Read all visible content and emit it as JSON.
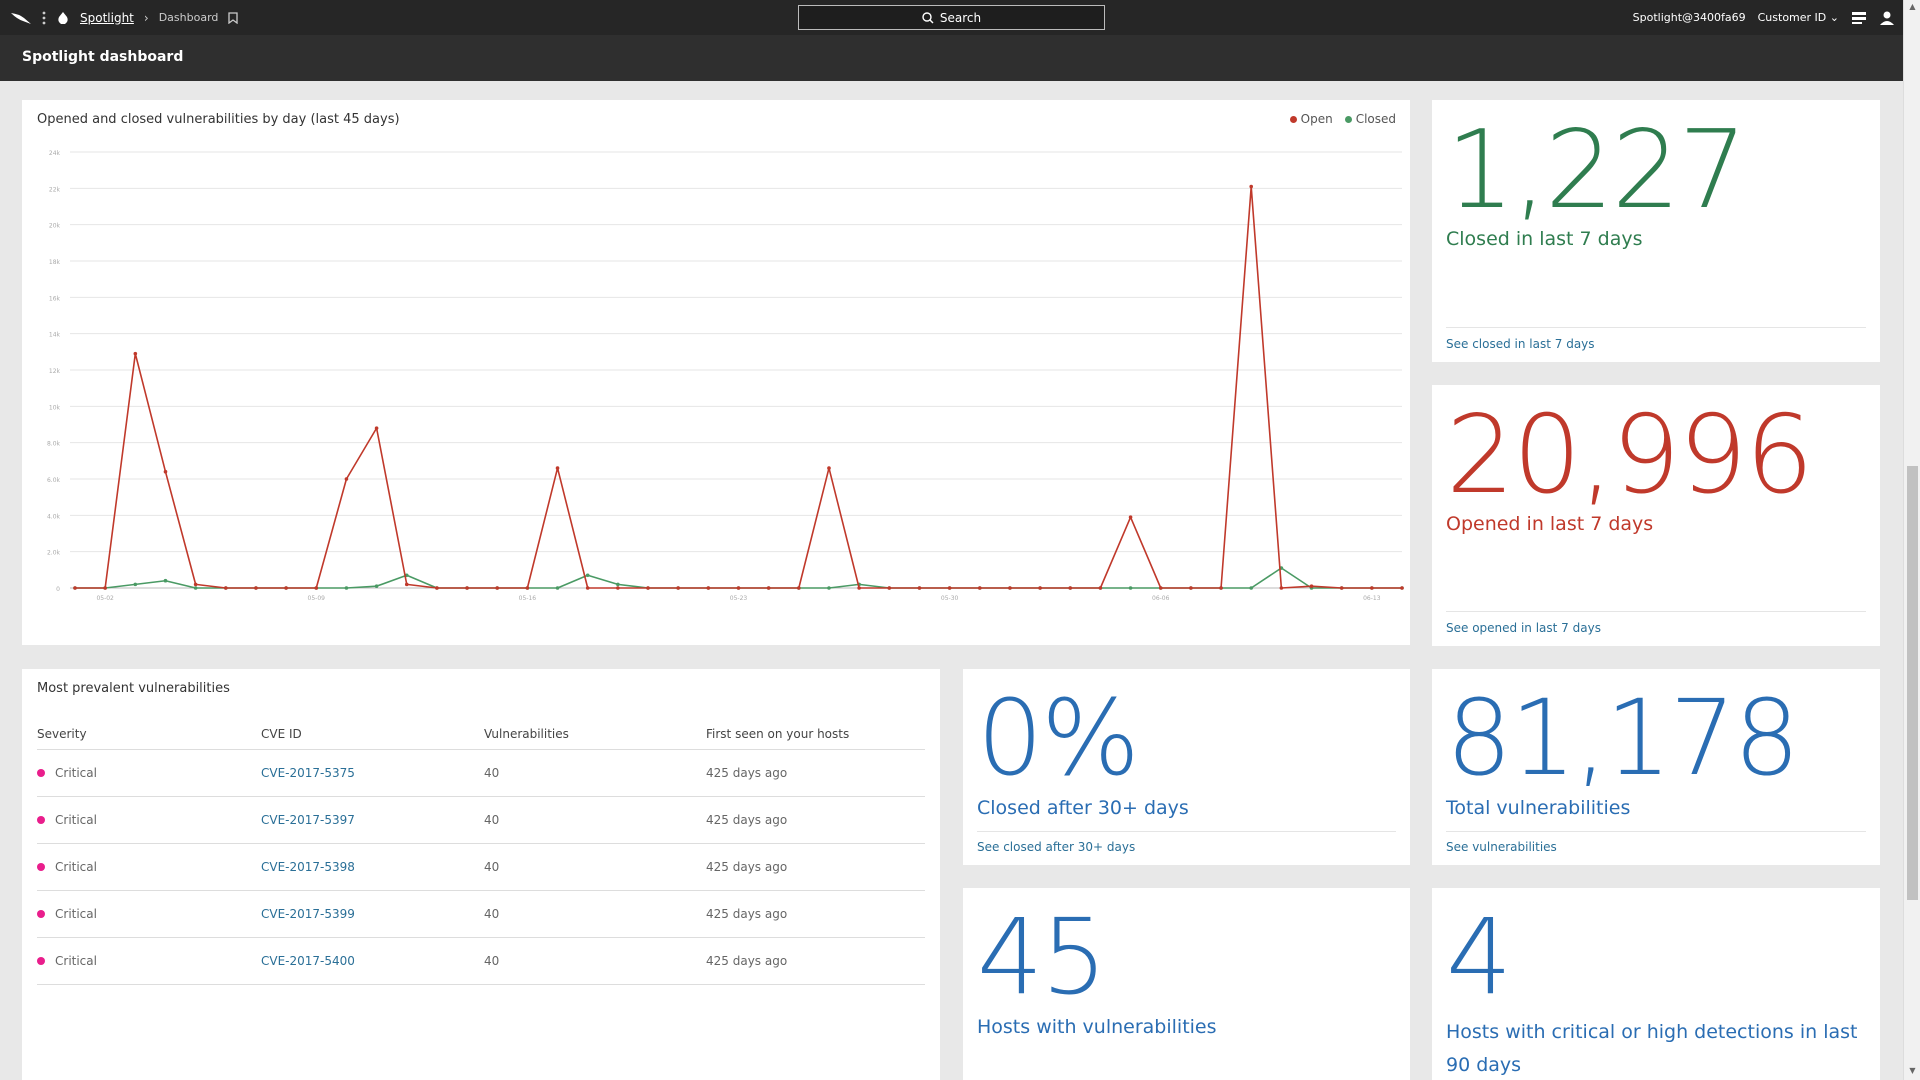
{
  "topbar": {
    "breadcrumb_link": "Spotlight",
    "breadcrumb_current": "Dashboard",
    "search_label": "Search",
    "user": "Spotlight@3400fa69",
    "customer_id_label": "Customer ID"
  },
  "header": {
    "title": "Spotlight dashboard"
  },
  "chart": {
    "title": "Opened and closed vulnerabilities by day (last 45 days)",
    "legend_open": "Open",
    "legend_closed": "Closed"
  },
  "chart_data": {
    "type": "line",
    "title": "Opened and closed vulnerabilities by day (last 45 days)",
    "y_ticks": [
      "0",
      "2.0k",
      "4.0k",
      "6.0k",
      "8.0k",
      "10k",
      "12k",
      "14k",
      "16k",
      "18k",
      "20k",
      "22k",
      "24k"
    ],
    "ylim": [
      0,
      24000
    ],
    "x_ticks": [
      {
        "index": 1,
        "label": "05-02"
      },
      {
        "index": 8,
        "label": "05-09"
      },
      {
        "index": 15,
        "label": "05-16"
      },
      {
        "index": 22,
        "label": "05-23"
      },
      {
        "index": 29,
        "label": "05-30"
      },
      {
        "index": 36,
        "label": "06-06"
      },
      {
        "index": 43,
        "label": "06-13"
      }
    ],
    "grid": true,
    "legend": "top-right",
    "series": [
      {
        "name": "Open",
        "color": "#c0392b",
        "values": [
          0,
          0,
          12900,
          6400,
          200,
          0,
          0,
          0,
          0,
          6000,
          8800,
          200,
          0,
          0,
          0,
          0,
          6600,
          0,
          0,
          0,
          0,
          0,
          0,
          0,
          0,
          6600,
          0,
          0,
          0,
          0,
          0,
          0,
          0,
          0,
          0,
          3900,
          0,
          0,
          0,
          22100,
          0,
          100,
          0,
          0,
          0
        ]
      },
      {
        "name": "Closed",
        "color": "#4a9a64",
        "values": [
          0,
          0,
          200,
          400,
          0,
          0,
          0,
          0,
          0,
          0,
          100,
          700,
          0,
          0,
          0,
          0,
          0,
          700,
          200,
          0,
          0,
          0,
          0,
          0,
          0,
          0,
          200,
          0,
          0,
          0,
          0,
          0,
          0,
          0,
          0,
          0,
          0,
          0,
          0,
          0,
          1100,
          0,
          0,
          0,
          0
        ]
      }
    ]
  },
  "stats": {
    "closed7": {
      "value": "1,227",
      "label": "Closed in last 7 days",
      "link": "See closed in last 7 days"
    },
    "open7": {
      "value": "20,996",
      "label": "Opened in last 7 days",
      "link": "See opened in last 7 days"
    },
    "after30": {
      "value": "0%",
      "label": "Closed after 30+ days",
      "link": "See closed after 30+ days"
    },
    "total": {
      "value": "81,178",
      "label": "Total vulnerabilities",
      "link": "See vulnerabilities"
    },
    "hosts": {
      "value": "45",
      "label": "Hosts with vulnerabilities"
    },
    "crit": {
      "value": "4",
      "label": "Hosts with critical or high detections in last 90 days"
    }
  },
  "prevalent": {
    "title": "Most prevalent vulnerabilities",
    "columns": [
      "Severity",
      "CVE ID",
      "Vulnerabilities",
      "First seen on your hosts"
    ],
    "rows": [
      {
        "severity": "Critical",
        "cve": "CVE-2017-5375",
        "count": "40",
        "first_seen": "425 days ago"
      },
      {
        "severity": "Critical",
        "cve": "CVE-2017-5397",
        "count": "40",
        "first_seen": "425 days ago"
      },
      {
        "severity": "Critical",
        "cve": "CVE-2017-5398",
        "count": "40",
        "first_seen": "425 days ago"
      },
      {
        "severity": "Critical",
        "cve": "CVE-2017-5399",
        "count": "40",
        "first_seen": "425 days ago"
      },
      {
        "severity": "Critical",
        "cve": "CVE-2017-5400",
        "count": "40",
        "first_seen": "425 days ago"
      }
    ]
  },
  "colors": {
    "open": "#c0392b",
    "closed": "#4a9a64",
    "critical": "#e91e8c",
    "link": "#2a6f97"
  }
}
